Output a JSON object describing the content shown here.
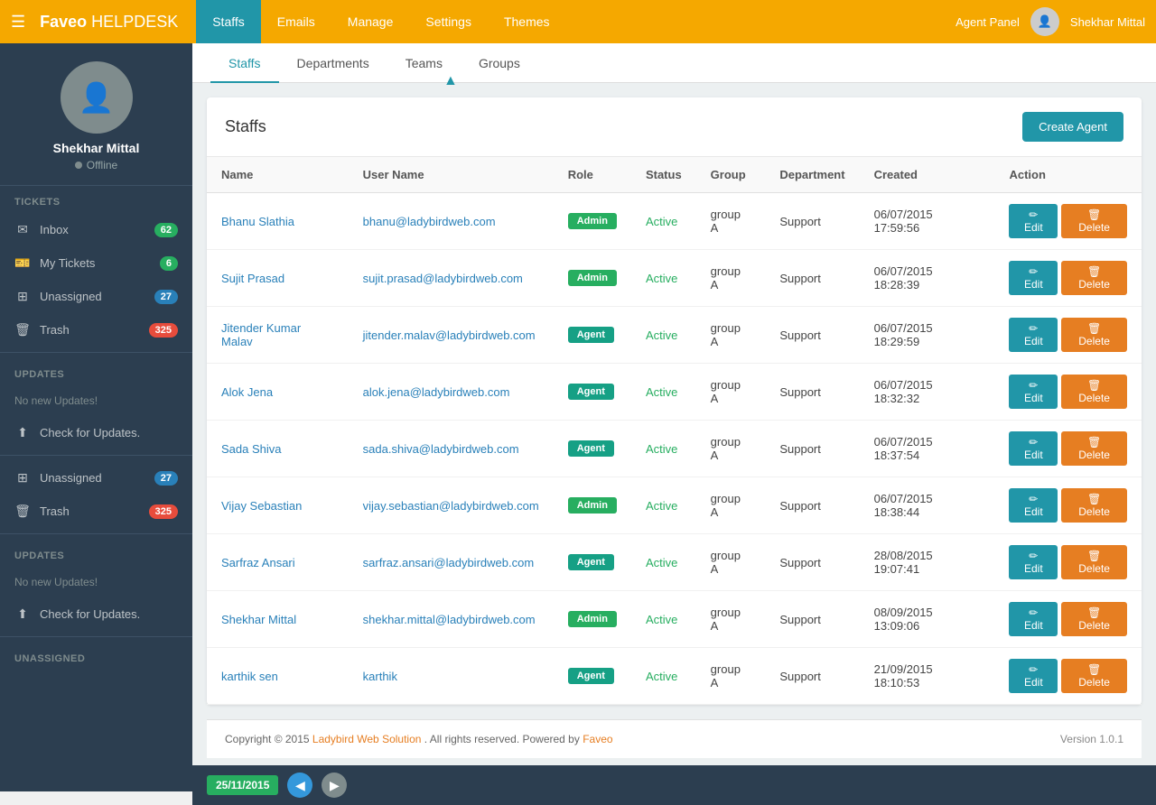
{
  "brand": {
    "name_bold": "Faveo",
    "name_light": " HELPDESK"
  },
  "nav": {
    "links": [
      {
        "label": "Staffs",
        "active": true
      },
      {
        "label": "Emails",
        "active": false
      },
      {
        "label": "Manage",
        "active": false
      },
      {
        "label": "Settings",
        "active": false
      },
      {
        "label": "Themes",
        "active": false
      }
    ],
    "agent_panel": "Agent Panel",
    "user_name": "Shekhar Mittal"
  },
  "sidebar": {
    "profile_name": "Shekhar Mittal",
    "profile_status": "Offline",
    "tickets_section": "TICKETS",
    "inbox_label": "Inbox",
    "inbox_count": "62",
    "my_tickets_label": "My Tickets",
    "my_tickets_count": "6",
    "unassigned_label": "Unassigned",
    "unassigned_count": "27",
    "trash_label": "Trash",
    "trash_count": "325",
    "updates_section": "UPDATES",
    "no_updates": "No new Updates!",
    "check_updates": "Check for Updates.",
    "unassigned2_label": "Unassigned",
    "unassigned2_count": "27",
    "trash2_label": "Trash",
    "trash2_count": "325",
    "updates2_section": "UPDATES",
    "no_updates2": "No new Updates!",
    "check_updates2": "Check for Updates.",
    "unassigned3_section": "UNASSIGNED"
  },
  "tabs": [
    {
      "label": "Staffs",
      "active": true
    },
    {
      "label": "Departments",
      "active": false
    },
    {
      "label": "Teams",
      "active": false
    },
    {
      "label": "Groups",
      "active": false
    }
  ],
  "content": {
    "title": "Staffs",
    "create_button": "Create Agent",
    "columns": [
      "Name",
      "User Name",
      "Role",
      "Status",
      "Group",
      "Department",
      "Created",
      "Action"
    ],
    "edit_label": "Edit",
    "delete_label": "Delete",
    "rows": [
      {
        "name": "Bhanu Slathia",
        "email": "bhanu@ladybirdweb.com",
        "role": "Admin",
        "role_type": "admin",
        "status": "Active",
        "group": "group A",
        "department": "Support",
        "created": "06/07/2015 17:59:56"
      },
      {
        "name": "Sujit Prasad",
        "email": "sujit.prasad@ladybirdweb.com",
        "role": "Admin",
        "role_type": "admin",
        "status": "Active",
        "group": "group A",
        "department": "Support",
        "created": "06/07/2015 18:28:39"
      },
      {
        "name": "Jitender Kumar Malav",
        "email": "jitender.malav@ladybirdweb.com",
        "role": "Agent",
        "role_type": "agent",
        "status": "Active",
        "group": "group A",
        "department": "Support",
        "created": "06/07/2015 18:29:59"
      },
      {
        "name": "Alok Jena",
        "email": "alok.jena@ladybirdweb.com",
        "role": "Agent",
        "role_type": "agent",
        "status": "Active",
        "group": "group A",
        "department": "Support",
        "created": "06/07/2015 18:32:32"
      },
      {
        "name": "Sada Shiva",
        "email": "sada.shiva@ladybirdweb.com",
        "role": "Agent",
        "role_type": "agent",
        "status": "Active",
        "group": "group A",
        "department": "Support",
        "created": "06/07/2015 18:37:54"
      },
      {
        "name": "Vijay Sebastian",
        "email": "vijay.sebastian@ladybirdweb.com",
        "role": "Admin",
        "role_type": "admin",
        "status": "Active",
        "group": "group A",
        "department": "Support",
        "created": "06/07/2015 18:38:44"
      },
      {
        "name": "Sarfraz Ansari",
        "email": "sarfraz.ansari@ladybirdweb.com",
        "role": "Agent",
        "role_type": "agent",
        "status": "Active",
        "group": "group A",
        "department": "Support",
        "created": "28/08/2015 19:07:41"
      },
      {
        "name": "Shekhar Mittal",
        "email": "shekhar.mittal@ladybirdweb.com",
        "role": "Admin",
        "role_type": "admin",
        "status": "Active",
        "group": "group A",
        "department": "Support",
        "created": "08/09/2015 13:09:06"
      },
      {
        "name": "karthik sen",
        "email": "karthik",
        "role": "Agent",
        "role_type": "agent",
        "status": "Active",
        "group": "group A",
        "department": "Support",
        "created": "21/09/2015 18:10:53"
      }
    ]
  },
  "footer": {
    "copyright": "Copyright © 2015",
    "company": "Ladybird Web Solution",
    "rights": ". All rights reserved. Powered by",
    "powered_by": "Faveo",
    "version_label": "Version",
    "version_number": "1.0.1"
  },
  "bottom_bar": {
    "date": "25/11/2015"
  }
}
